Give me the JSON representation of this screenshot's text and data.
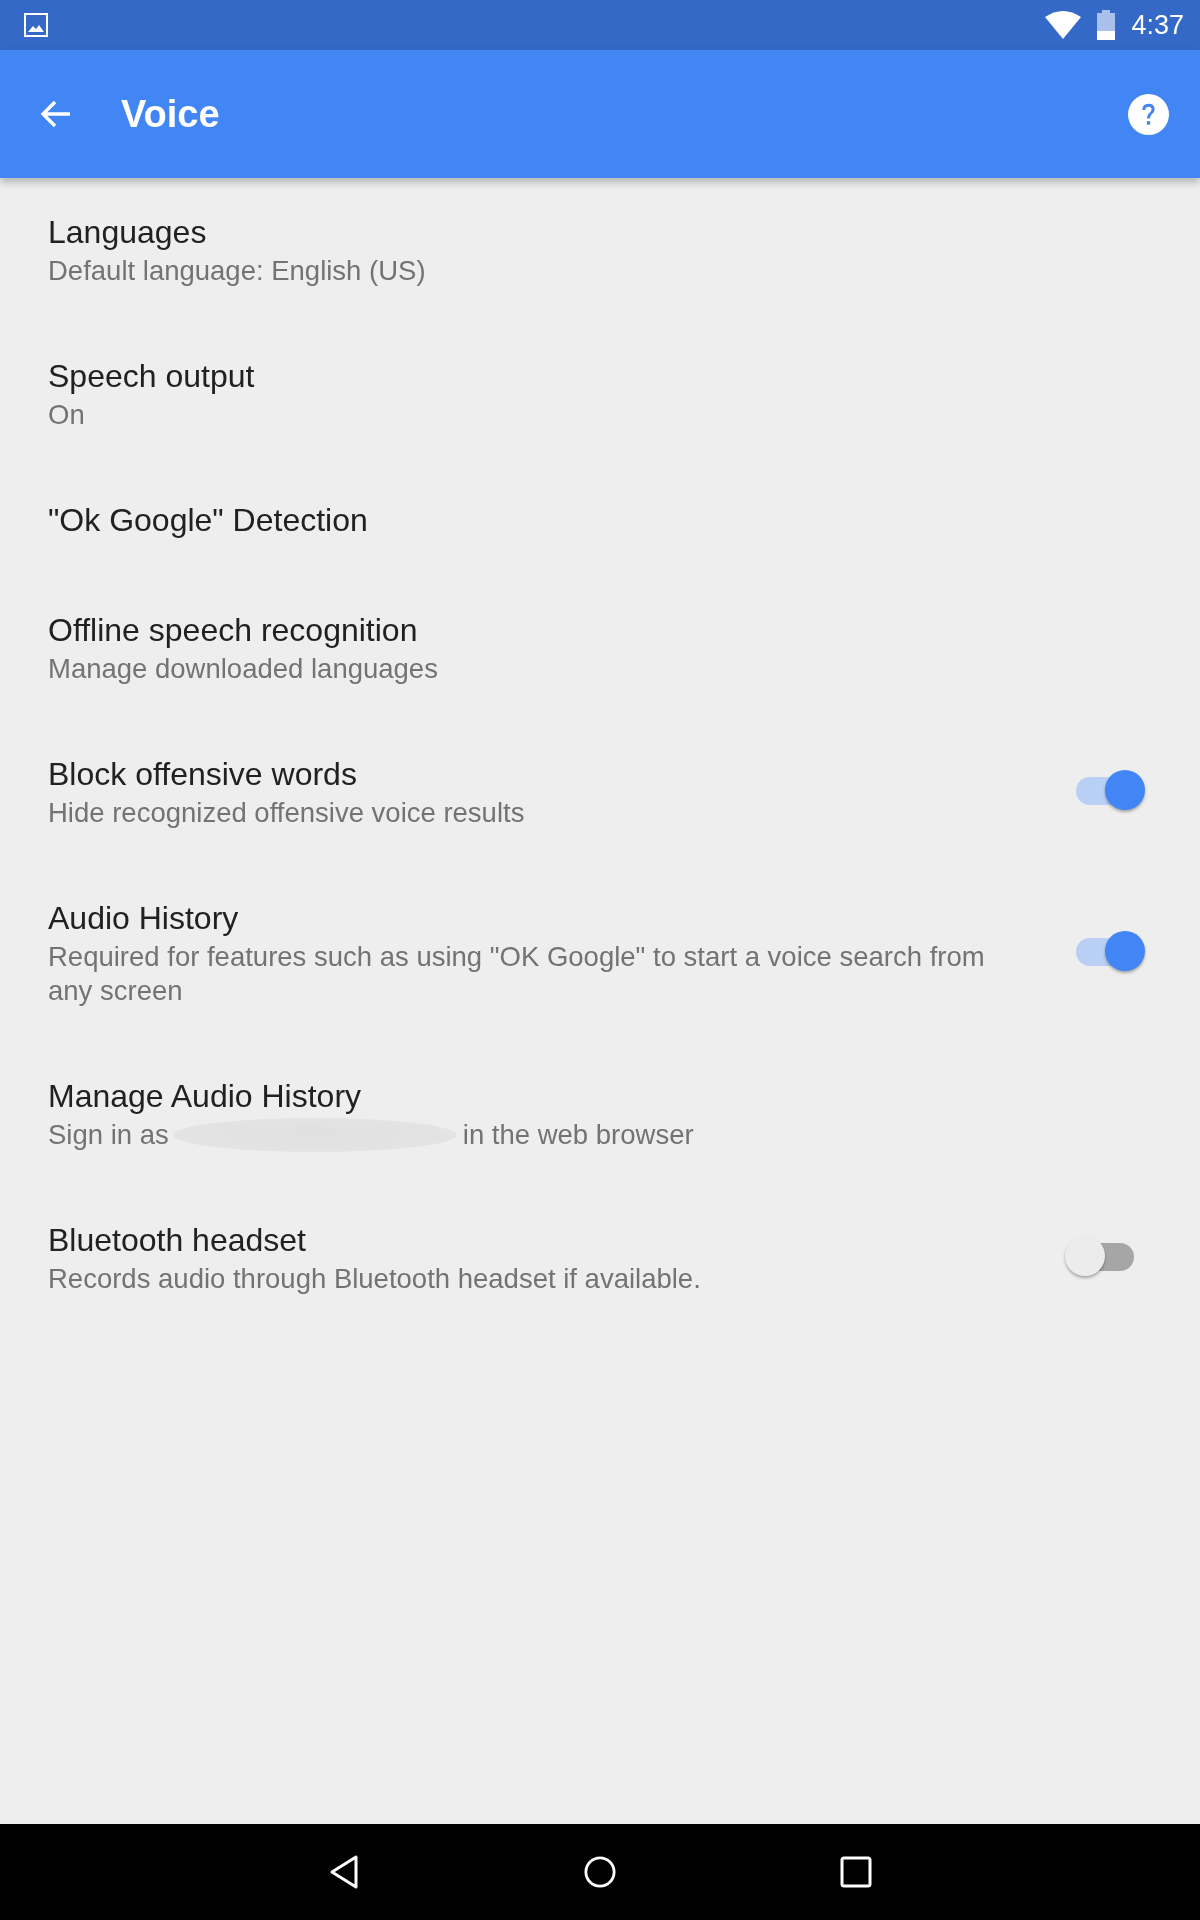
{
  "status_bar": {
    "time": "4:37"
  },
  "app_bar": {
    "title": "Voice"
  },
  "settings": [
    {
      "kind": "plain",
      "title": "Languages",
      "subtitle": "Default language: English (US)"
    },
    {
      "kind": "plain",
      "title": "Speech output",
      "subtitle": "On"
    },
    {
      "kind": "plain",
      "title": "\"Ok Google\" Detection"
    },
    {
      "kind": "plain",
      "title": "Offline speech recognition",
      "subtitle": "Manage downloaded languages"
    },
    {
      "kind": "toggle",
      "title": "Block offensive words",
      "subtitle": "Hide recognized offensive voice results",
      "on": true
    },
    {
      "kind": "toggle",
      "title": "Audio History",
      "subtitle": "Required for features such as using \"OK Google\" to start a voice search from any screen",
      "on": true
    },
    {
      "kind": "redacted",
      "title": "Manage Audio History",
      "subtitle_start": "Sign in as",
      "subtitle_end": "in the web browser"
    },
    {
      "kind": "toggle",
      "title": "Bluetooth headset",
      "subtitle": "Records audio through Bluetooth headset if available.",
      "on": false
    }
  ]
}
